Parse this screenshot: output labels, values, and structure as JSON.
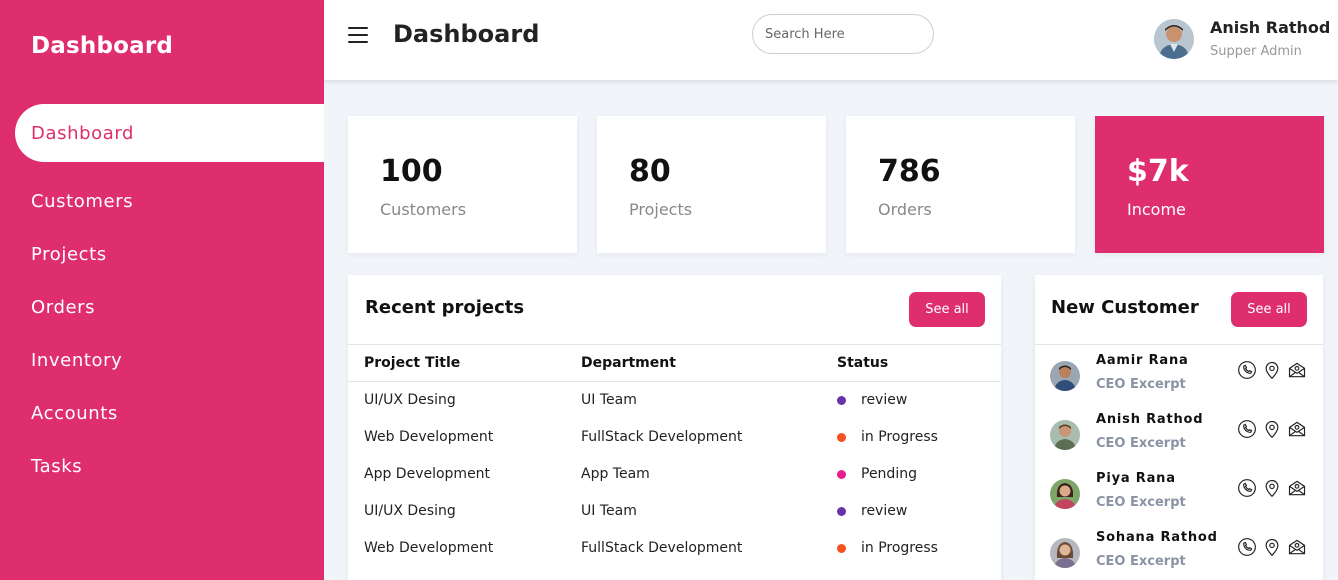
{
  "sidebar": {
    "brand": "Dashboard",
    "items": [
      {
        "label": "Dashboard",
        "active": true
      },
      {
        "label": "Customers"
      },
      {
        "label": "Projects"
      },
      {
        "label": "Orders"
      },
      {
        "label": "Inventory"
      },
      {
        "label": "Accounts"
      },
      {
        "label": "Tasks"
      }
    ]
  },
  "header": {
    "title": "Dashboard",
    "search_placeholder": "Search Here",
    "user": {
      "name": "Anish Rathod",
      "role": "Supper Admin"
    }
  },
  "stats": [
    {
      "value": "100",
      "label": "Customers"
    },
    {
      "value": "80",
      "label": "Projects"
    },
    {
      "value": "786",
      "label": "Orders"
    },
    {
      "value": "$7k",
      "label": "Income"
    }
  ],
  "recent_projects": {
    "title": "Recent projects",
    "button": "See all",
    "columns": [
      "Project Title",
      "Department",
      "Status"
    ],
    "rows": [
      {
        "title": "UI/UX Desing",
        "department": "UI Team",
        "status": "review",
        "color": "#6a32a8"
      },
      {
        "title": "Web Development",
        "department": "FullStack Development",
        "status": "in Progress",
        "color": "#f4511e"
      },
      {
        "title": "App Development",
        "department": "App Team",
        "status": "Pending",
        "color": "#e91e8c"
      },
      {
        "title": "UI/UX Desing",
        "department": "UI Team",
        "status": "review",
        "color": "#6a32a8"
      },
      {
        "title": "Web Development",
        "department": "FullStack Development",
        "status": "in Progress",
        "color": "#f4511e"
      }
    ]
  },
  "new_customer": {
    "title": "New Customer",
    "button": "See all",
    "items": [
      {
        "name": "Aamir Rana",
        "role": "CEO Excerpt"
      },
      {
        "name": "Anish Rathod",
        "role": "CEO Excerpt"
      },
      {
        "name": "Piya Rana",
        "role": "CEO Excerpt"
      },
      {
        "name": "Sohana Rathod",
        "role": "CEO Excerpt"
      }
    ],
    "action_icons": [
      "phone-icon",
      "location-pin-icon",
      "mail-icon"
    ]
  },
  "colors": {
    "accent": "#df2e6d",
    "background": "#f1f5f9"
  }
}
